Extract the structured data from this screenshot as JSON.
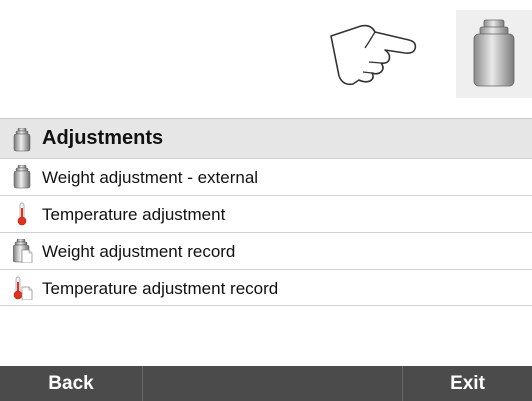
{
  "hint": {
    "hand_icon": "pointing-hand-icon",
    "weight_icon": "weight-icon"
  },
  "panel": {
    "title": "Adjustments",
    "title_icon": "weight-icon",
    "items": [
      {
        "label": "Weight adjustment - external",
        "icon": "weight-icon"
      },
      {
        "label": "Temperature adjustment",
        "icon": "thermometer-icon"
      },
      {
        "label": "Weight adjustment record",
        "icon": "weight-record-icon"
      },
      {
        "label": "Temperature adjustment record",
        "icon": "temperature-record-icon"
      }
    ]
  },
  "footer": {
    "back_label": "Back",
    "middle_label": "",
    "exit_label": "Exit"
  },
  "colors": {
    "header_bg": "#e6e6e6",
    "footer_bg": "#4b4b4b",
    "thermometer_red": "#e03020"
  }
}
